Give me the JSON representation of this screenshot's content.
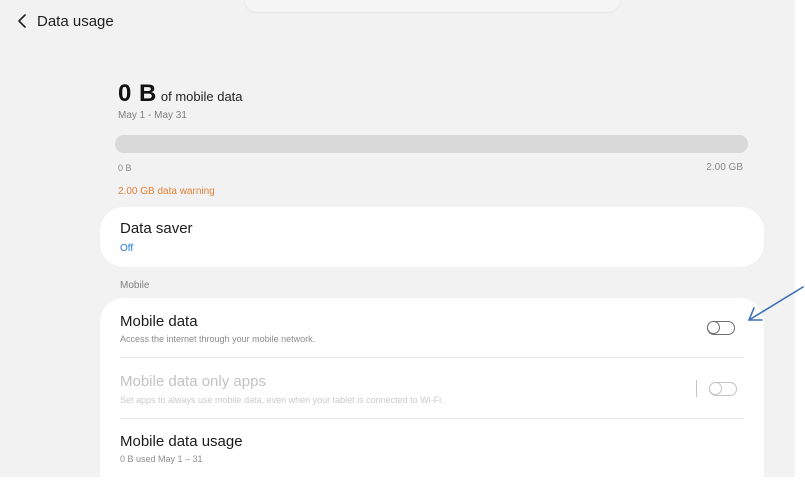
{
  "header": {
    "back_icon": "chevron-left-icon",
    "title": "Data usage"
  },
  "usage": {
    "amount": "0 B",
    "label": "of mobile data",
    "period": "May 1 - May 31",
    "progress_fraction": 0,
    "scale_min": "0 B",
    "scale_max": "2.00 GB",
    "warning": "2.00 GB data warning",
    "warning_color": "#e0803a"
  },
  "data_saver": {
    "title": "Data saver",
    "status": "Off"
  },
  "mobile_section": {
    "label": "Mobile",
    "items": [
      {
        "title": "Mobile data",
        "subtitle": "Access the internet through your mobile network.",
        "toggle": "off",
        "enabled": true
      },
      {
        "title": "Mobile data only apps",
        "subtitle": "Set apps to always use mobile data, even when your tablet is connected to Wi-Fi.",
        "toggle": "off",
        "enabled": false
      },
      {
        "title": "Mobile data usage",
        "subtitle": "0 B used May 1 – 31"
      }
    ]
  },
  "colors": {
    "accent": "#2a7bd6",
    "annotation_arrow": "#3b6fb6"
  }
}
